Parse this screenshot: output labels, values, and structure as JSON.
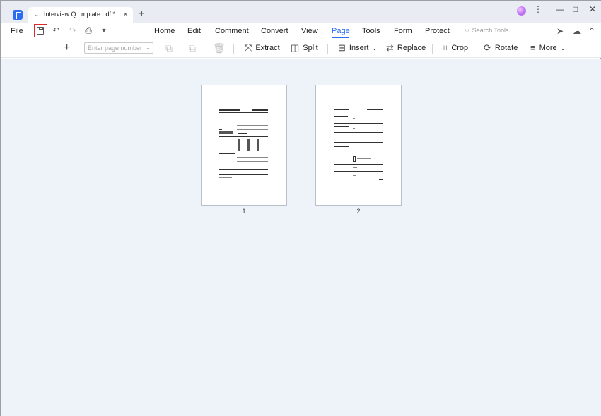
{
  "window": {
    "tab_title": "Interview Q...mplate.pdf *",
    "tab_close": "×",
    "new_tab": "+",
    "controls": {
      "more": "⋮",
      "minimize": "—",
      "maximize": "□",
      "close": "✕"
    }
  },
  "menubar": {
    "file": "File",
    "quick_icons": [
      "save-icon",
      "undo-icon",
      "redo-icon",
      "print-icon",
      "customize-icon"
    ],
    "nav": [
      "Home",
      "Edit",
      "Comment",
      "Convert",
      "View",
      "Page",
      "Tools",
      "Form",
      "Protect"
    ],
    "active_nav": "Page",
    "search_tools": "Search Tools",
    "right_icons": [
      "send-icon",
      "cloud-upload-icon",
      "collapse-icon"
    ]
  },
  "toolbar": {
    "page_number_placeholder": "Enter page number",
    "page_number_value": "",
    "extract": "Extract",
    "split": "Split",
    "insert": "Insert",
    "replace": "Replace",
    "crop": "Crop",
    "rotate": "Rotate",
    "more": "More"
  },
  "pages": [
    {
      "label": "1"
    },
    {
      "label": "2"
    }
  ],
  "colors": {
    "accent": "#2c6df2",
    "highlight": "#d92b2b",
    "workspace_bg": "#eef2f9",
    "titlebar_bg": "#e9edf3"
  }
}
